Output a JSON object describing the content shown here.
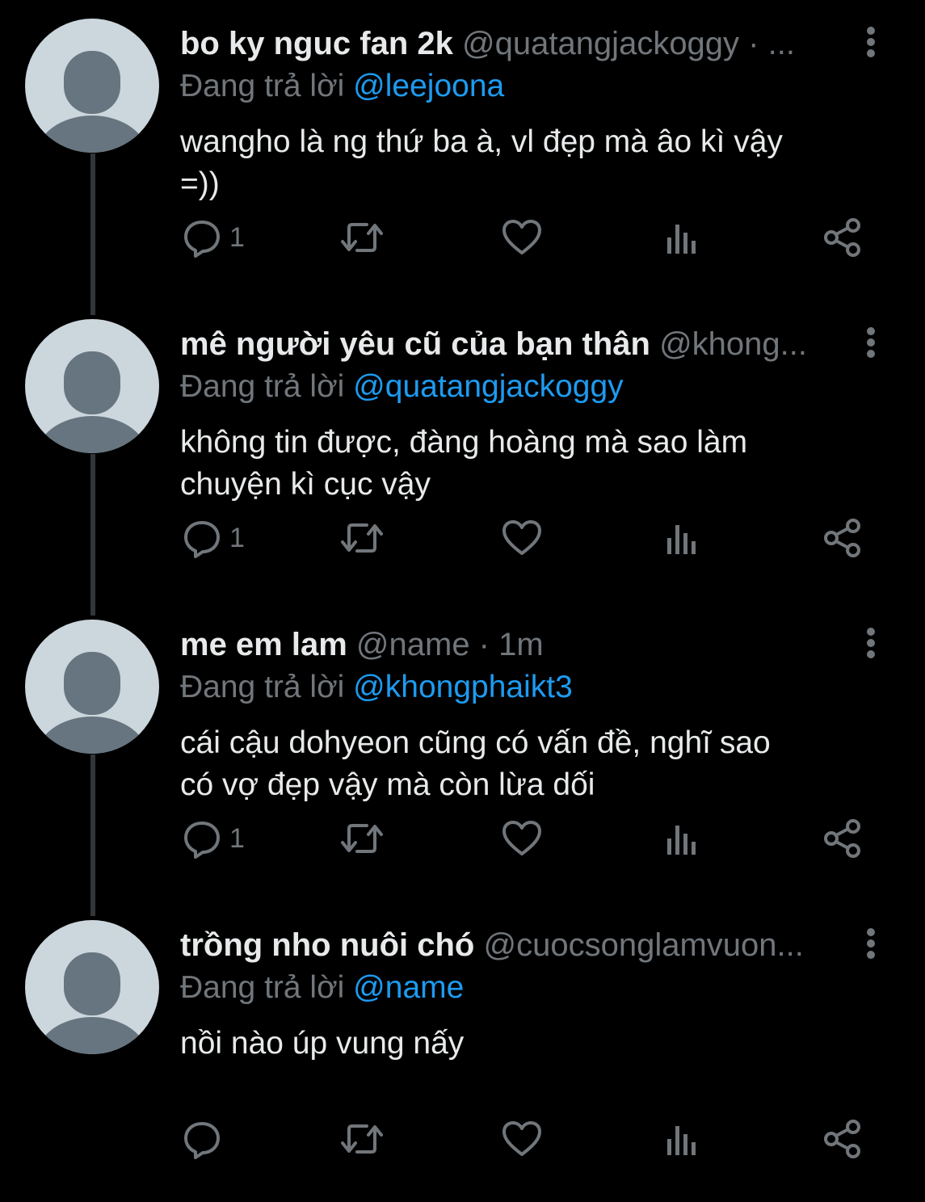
{
  "colors": {
    "background": "#000000",
    "text_primary": "#e7e9ea",
    "text_secondary": "#71767b",
    "accent": "#1d9bf0",
    "thread_line": "#333639",
    "avatar_bg": "#ccd6dd",
    "avatar_figure": "#66757f"
  },
  "tweets": [
    {
      "display_name": "bo ky nguc fan 2k",
      "handle": "@quatangjackoggy · ...",
      "reply_prefix": "Đang trả lời",
      "reply_to": "@leejoona",
      "text_lines": [
        "wangho là ng thứ ba à, vl đẹp mà âo kì vậy",
        "=))"
      ],
      "reply_count": "1",
      "icons": [
        "reply-icon",
        "retweet-icon",
        "like-icon",
        "views-icon",
        "share-icon",
        "more-icon"
      ]
    },
    {
      "display_name": "mê người yêu cũ của bạn thân",
      "handle": "@khong...",
      "reply_prefix": "Đang trả lời",
      "reply_to": "@quatangjackoggy",
      "text_lines": [
        "không tin được, đàng hoàng mà sao làm",
        "chuyện kì cục vậy"
      ],
      "reply_count": "1",
      "icons": [
        "reply-icon",
        "retweet-icon",
        "like-icon",
        "views-icon",
        "share-icon",
        "more-icon"
      ]
    },
    {
      "display_name": "me em lam",
      "handle": "@name · 1m",
      "reply_prefix": "Đang trả lời",
      "reply_to": "@khongphaikt3",
      "text_lines": [
        "cái cậu dohyeon cũng có vấn đề, nghĩ sao",
        "có vợ đẹp vậy mà còn lừa dối"
      ],
      "reply_count": "1",
      "icons": [
        "reply-icon",
        "retweet-icon",
        "like-icon",
        "views-icon",
        "share-icon",
        "more-icon"
      ]
    },
    {
      "display_name": "trồng nho nuôi chó",
      "handle": "@cuocsonglamvuon...",
      "reply_prefix": "Đang trả lời",
      "reply_to": "@name",
      "text_lines": [
        "nồi nào úp vung nấy",
        ""
      ],
      "reply_count": "",
      "icons": [
        "reply-icon",
        "retweet-icon",
        "like-icon",
        "views-icon",
        "share-icon",
        "more-icon"
      ]
    }
  ]
}
